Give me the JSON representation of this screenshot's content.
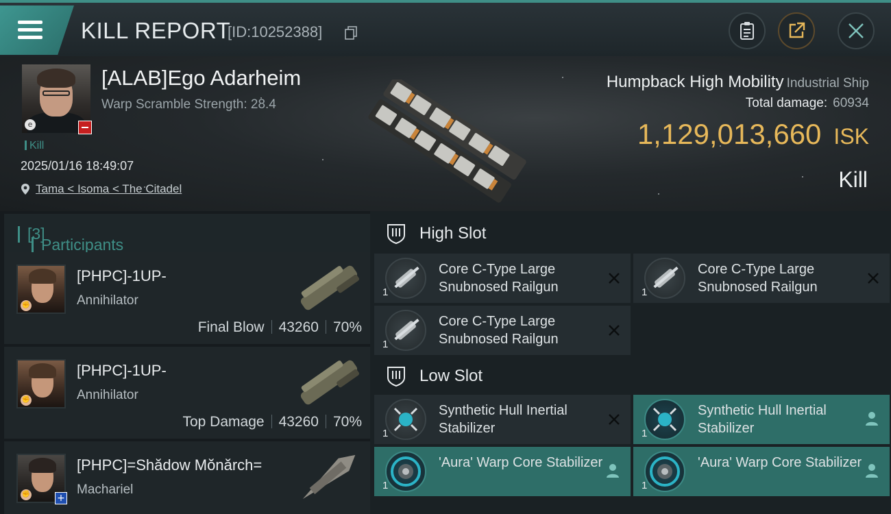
{
  "header_bar": {
    "title": "KILL REPORT",
    "report_id": "[ID:10252388]",
    "icons": [
      "menu-icon",
      "copy-icon",
      "clipboard-icon",
      "share-icon",
      "close-icon"
    ]
  },
  "victim": {
    "name": "[ALAB]Ego Adarheim",
    "scramble": "Warp Scramble Strength: 28.4",
    "tag": "Kill",
    "datetime": "2025/01/16 18:49:07",
    "location": "Tama < Isoma < The Citadel",
    "ship_name": "Humpback High Mobility",
    "ship_class": "Industrial Ship",
    "total_damage_label": "Total damage:",
    "total_damage": "60934",
    "isk_value": "1,129,013,660",
    "isk_unit": "ISK",
    "result": "Kill"
  },
  "participants": {
    "heading": "Participants",
    "count": "[3]",
    "rows": [
      {
        "name": "[PHPC]-1UP-",
        "ship": "Annihilator",
        "role": "Final Blow",
        "damage": "43260",
        "percent": "70%"
      },
      {
        "name": "[PHPC]-1UP-",
        "ship": "Annihilator",
        "role": "Top Damage",
        "damage": "43260",
        "percent": "70%"
      },
      {
        "name": "[PHPC]=Shădow Mŏnărch=",
        "ship": "Machariel",
        "role": "",
        "damage": "",
        "percent": ""
      }
    ]
  },
  "slots": {
    "high": {
      "label": "High Slot",
      "modules": [
        {
          "name": "Core C-Type Large Snubnosed Railgun",
          "qty": "1",
          "status": "destroyed"
        },
        {
          "name": "Core C-Type Large Snubnosed Railgun",
          "qty": "1",
          "status": "destroyed"
        },
        {
          "name": "Core C-Type Large Snubnosed Railgun",
          "qty": "1",
          "status": "destroyed"
        }
      ]
    },
    "low": {
      "label": "Low Slot",
      "modules": [
        {
          "name": "Synthetic Hull Inertial Stabilizer",
          "qty": "1",
          "status": "destroyed"
        },
        {
          "name": "Synthetic Hull Inertial Stabilizer",
          "qty": "1",
          "status": "dropped"
        },
        {
          "name": "'Aura' Warp Core Stabilizer",
          "qty": "1",
          "status": "dropped"
        },
        {
          "name": "'Aura' Warp Core Stabilizer",
          "qty": "1",
          "status": "dropped"
        }
      ]
    }
  },
  "colors": {
    "accent": "#3f8f87",
    "isk": "#e7b85a",
    "dropped_bg": "#2e6e68",
    "destroyed_bg": "#252d31"
  }
}
